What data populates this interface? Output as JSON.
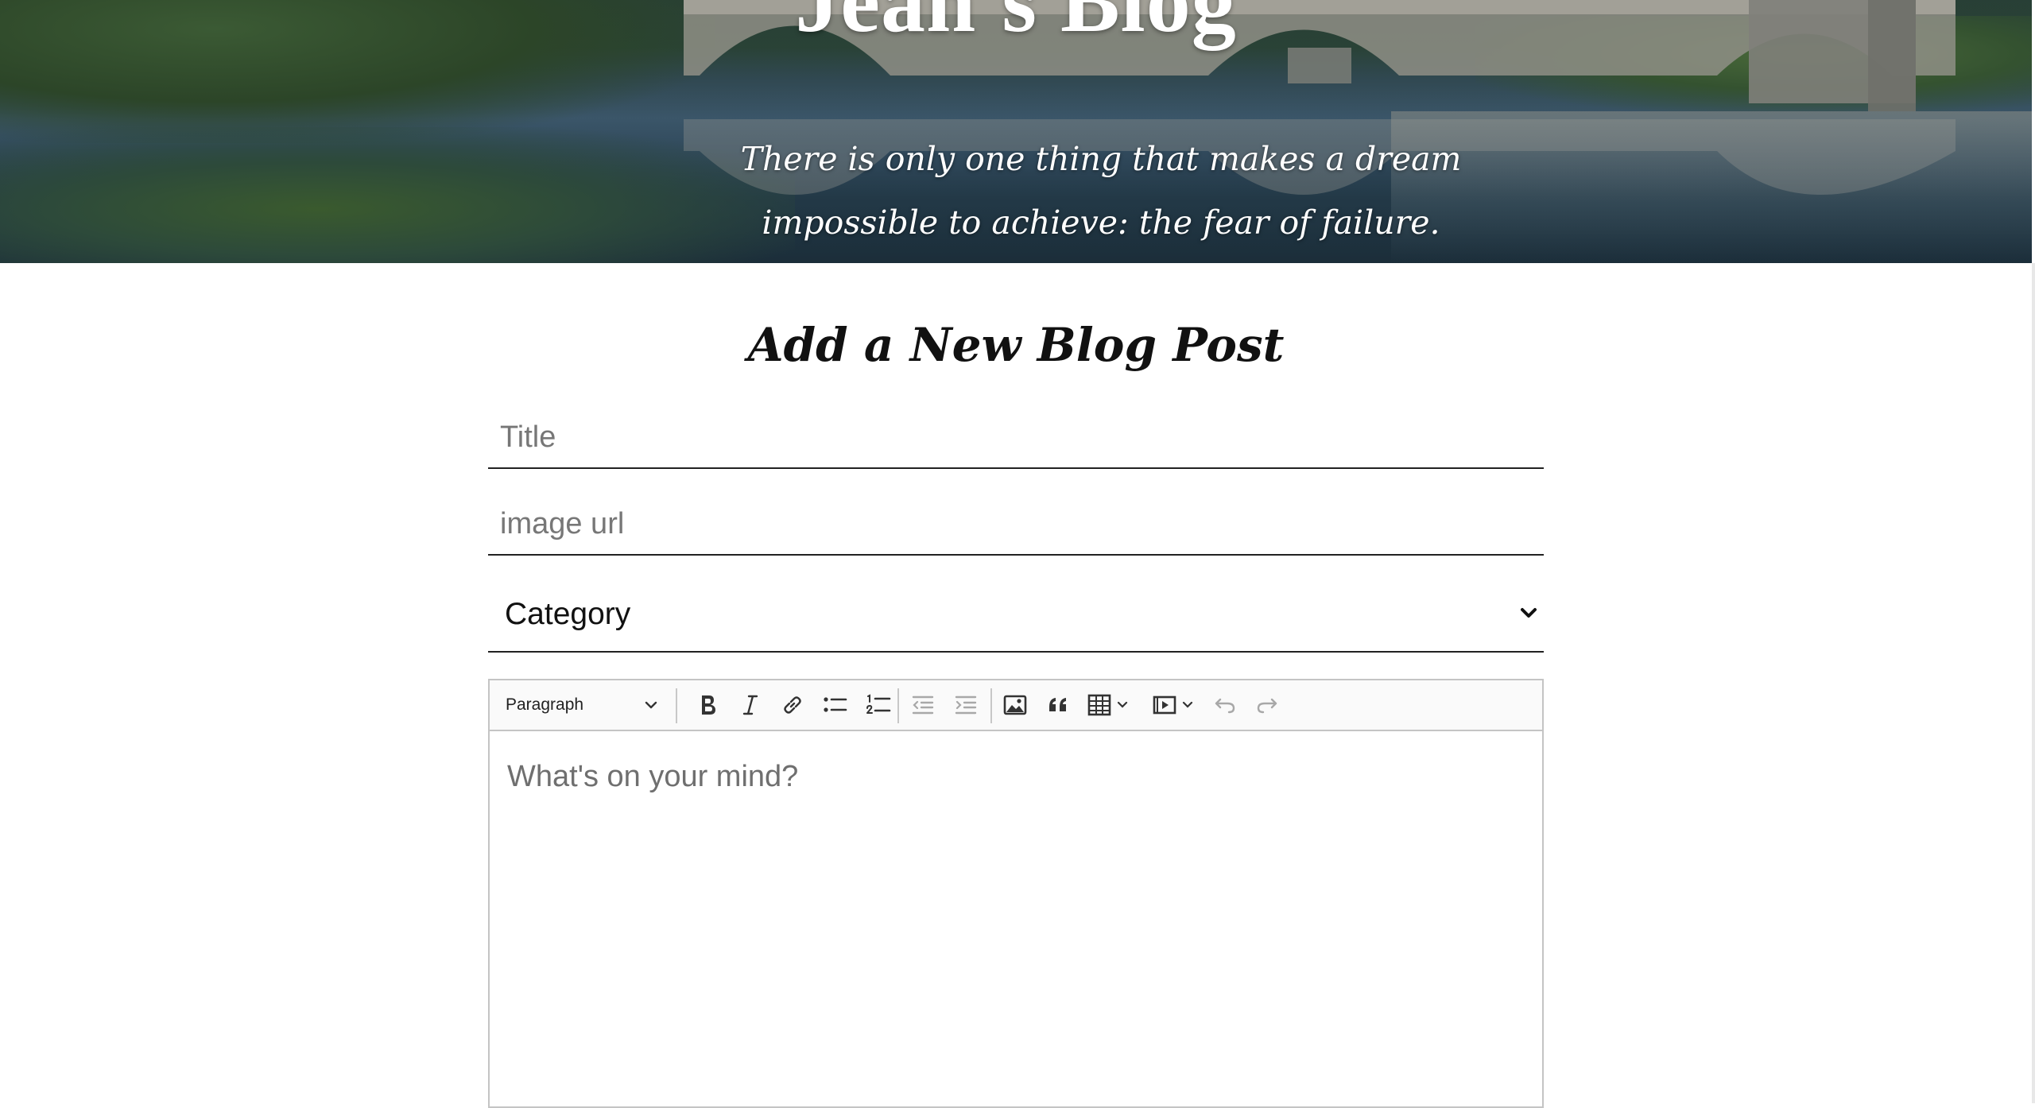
{
  "header": {
    "blog_title": "Jean's Blog",
    "tagline": "There is only one thing that makes a dream impossible to achieve: the fear of failure."
  },
  "form": {
    "heading": "Add a New Blog Post",
    "title_placeholder": "Title",
    "image_url_placeholder": "image url",
    "category_label": "Category"
  },
  "editor": {
    "block_style": "Paragraph",
    "placeholder": "What's on your mind?",
    "toolbar_icons": [
      "bold-icon",
      "italic-icon",
      "link-icon",
      "bulleted-list-icon",
      "numbered-list-icon",
      "outdent-icon",
      "indent-icon",
      "image-icon",
      "blockquote-icon",
      "table-icon",
      "media-embed-icon",
      "undo-icon",
      "redo-icon"
    ]
  },
  "colors": {
    "text": "#111111",
    "placeholder": "#777777",
    "toolbar_bg": "#fafafa",
    "border": "#c4c4c4"
  }
}
